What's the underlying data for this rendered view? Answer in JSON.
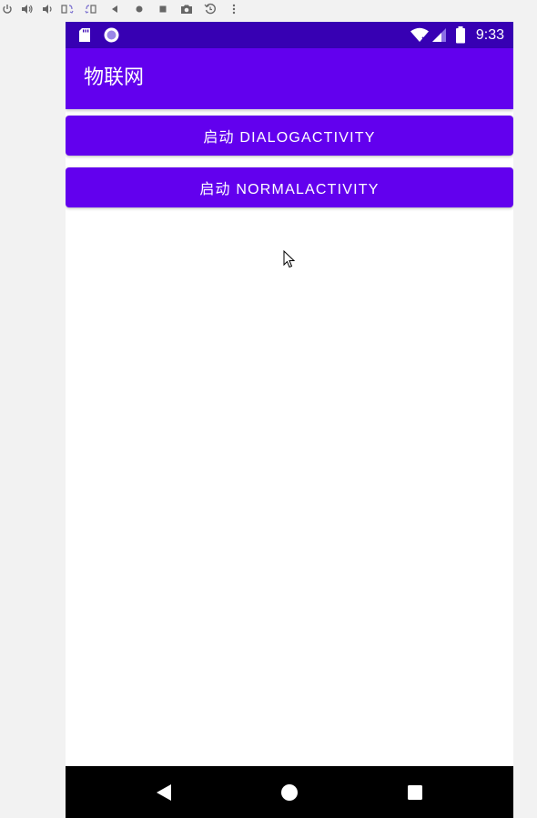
{
  "status_bar": {
    "time": "9:33"
  },
  "app_bar": {
    "title": "物联网"
  },
  "buttons": {
    "dialog_label": "启动 DIALOGACTIVITY",
    "normal_label": "启动 NORMALACTIVITY"
  },
  "colors": {
    "primary": "#6200ee",
    "primary_dark": "#3700b3",
    "nav_bar": "#000000"
  },
  "icons": {
    "emulator_toolbar": [
      "power-icon",
      "volume-up-icon",
      "volume-down-icon",
      "rotate-left-icon",
      "rotate-right-icon",
      "back-icon",
      "home-icon",
      "overview-icon",
      "camera-icon",
      "zoom-icon",
      "more-icon"
    ],
    "status_left": [
      "sd-card-icon",
      "sync-icon"
    ],
    "status_right": [
      "wifi-icon",
      "signal-icon",
      "battery-icon"
    ],
    "navigation": [
      "nav-back-icon",
      "nav-home-icon",
      "nav-recents-icon"
    ]
  }
}
